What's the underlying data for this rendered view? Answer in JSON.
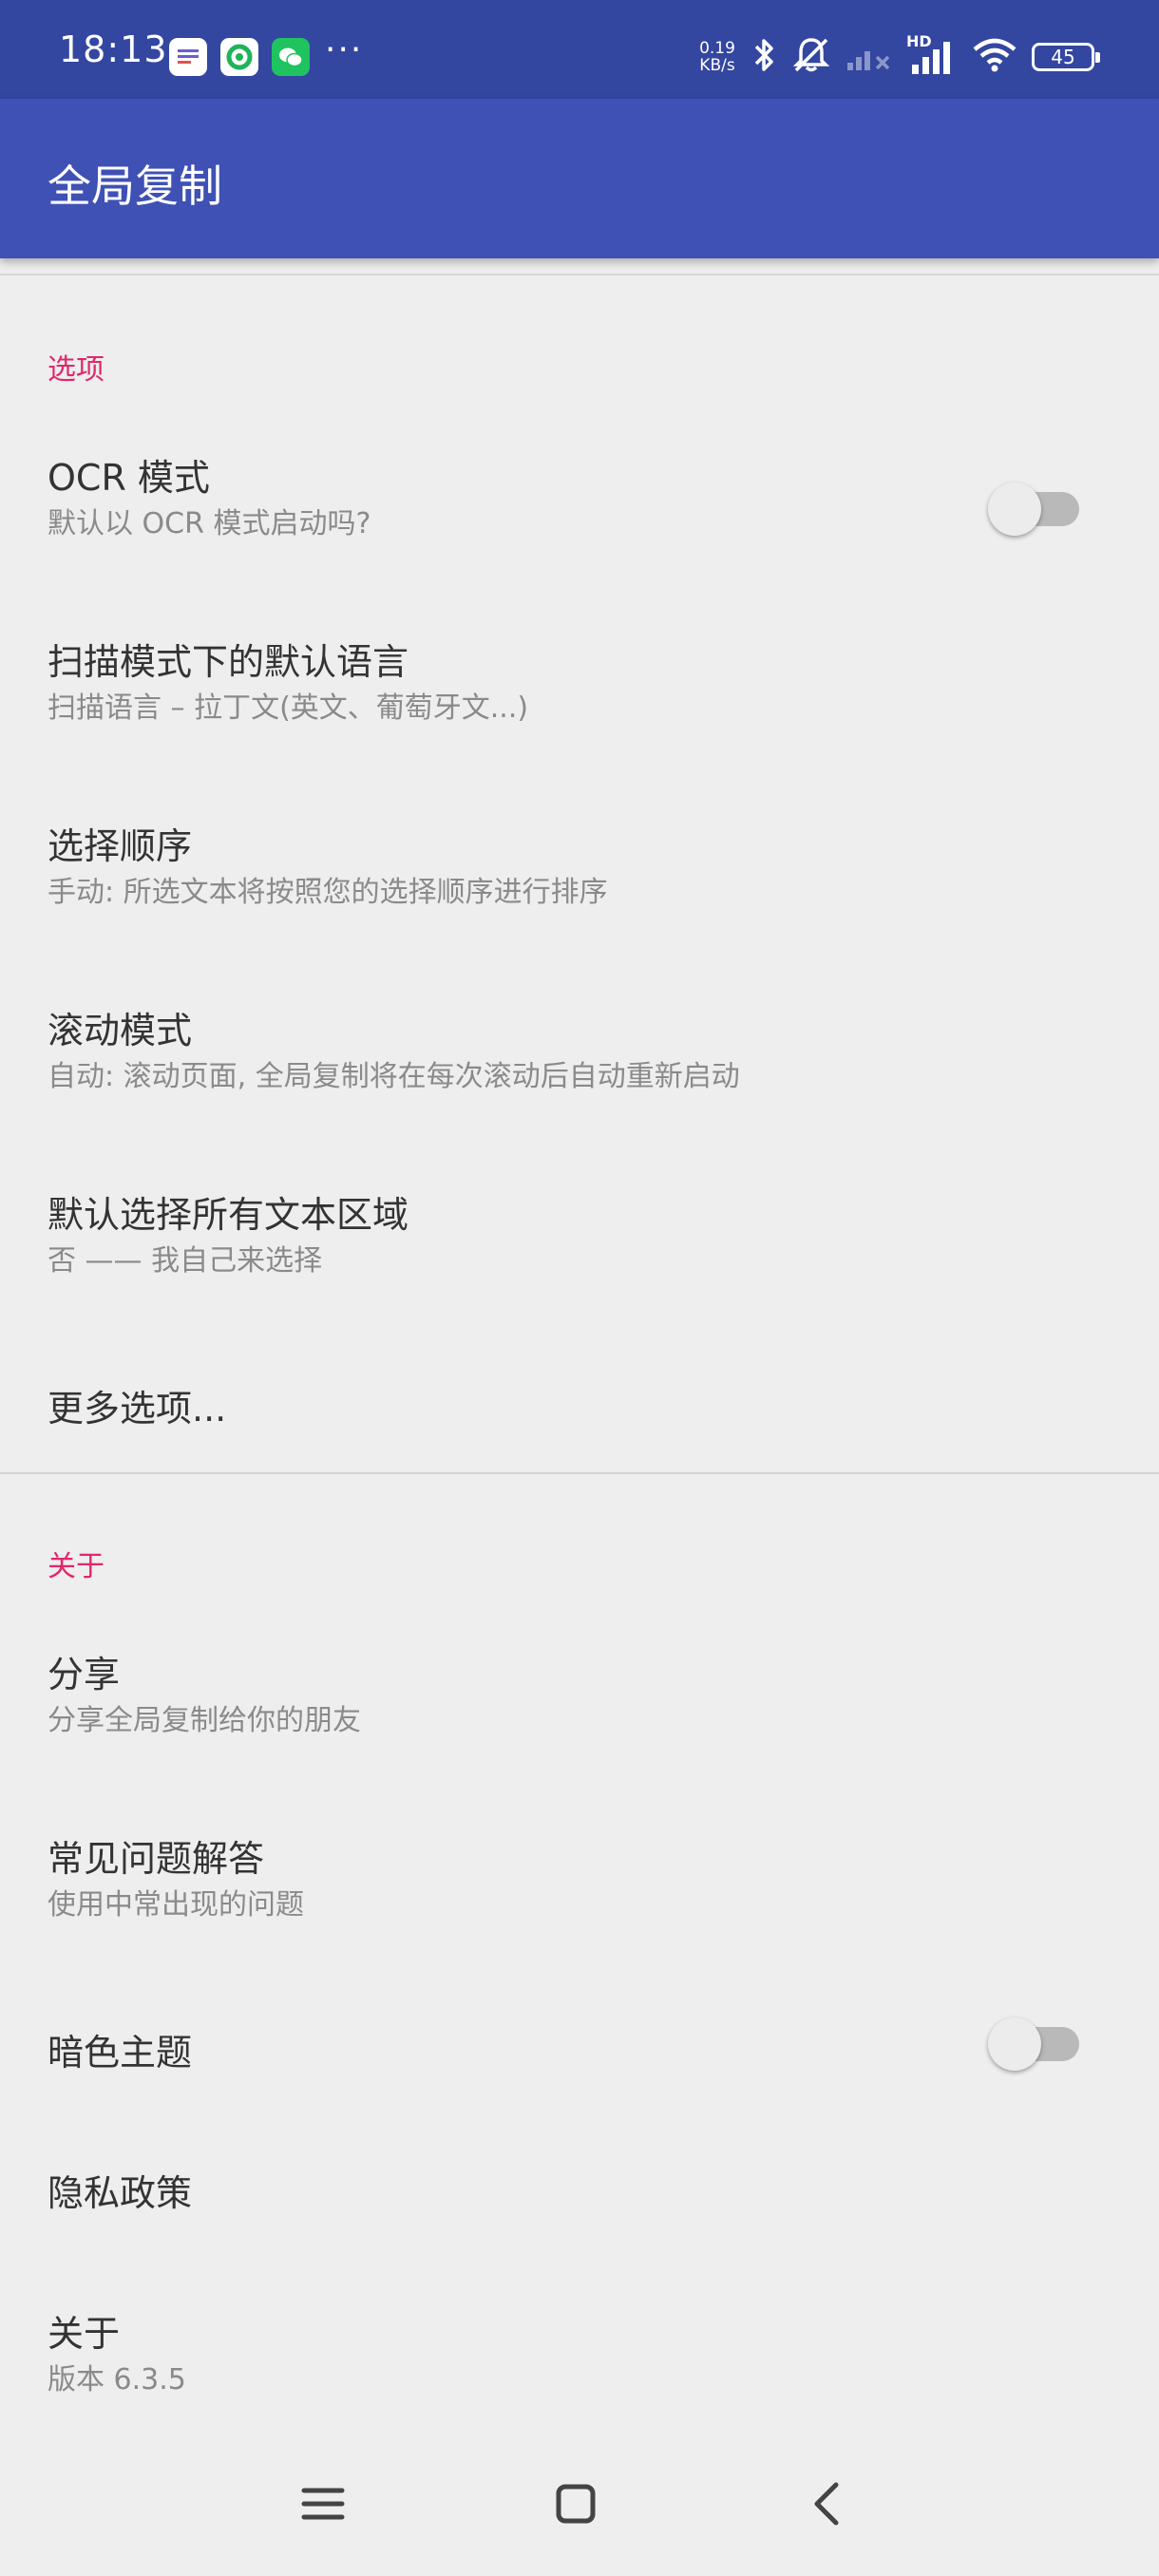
{
  "status_bar": {
    "time": "18:13",
    "net_speed_value": "0.19",
    "net_speed_unit": "KB/s",
    "network_label": "HD",
    "battery": "45"
  },
  "app_bar": {
    "title": "全局复制"
  },
  "sections": {
    "options": {
      "header": "选项",
      "ocr_mode": {
        "title": "OCR 模式",
        "summary": "默认以 OCR 模式启动吗?",
        "enabled": false
      },
      "scan_language": {
        "title": "扫描模式下的默认语言",
        "summary": "扫描语言 – 拉丁文(英文、葡萄牙文...)"
      },
      "selection_order": {
        "title": "选择顺序",
        "summary": "手动: 所选文本将按照您的选择顺序进行排序"
      },
      "scroll_mode": {
        "title": "滚动模式",
        "summary": "自动: 滚动页面, 全局复制将在每次滚动后自动重新启动"
      },
      "select_all": {
        "title": "默认选择所有文本区域",
        "summary": "否 —— 我自己来选择"
      },
      "more": {
        "title": "更多选项..."
      }
    },
    "about": {
      "header": "关于",
      "share": {
        "title": "分享",
        "summary": "分享全局复制给你的朋友"
      },
      "faq": {
        "title": "常见问题解答",
        "summary": "使用中常出现的问题"
      },
      "dark_theme": {
        "title": "暗色主题",
        "enabled": false
      },
      "privacy": {
        "title": "隐私政策"
      },
      "about_item": {
        "title": "关于",
        "summary": "版本 6.3.5"
      }
    }
  },
  "colors": {
    "status_bar": "#3346a0",
    "app_bar": "#3f51b5",
    "accent": "#e2266c",
    "background": "#eeeeee"
  },
  "icons": {
    "notifications": [
      "message-app-icon",
      "green-app-icon",
      "wechat-icon"
    ],
    "status": [
      "bluetooth-icon",
      "muted-bell-icon",
      "signal-icon",
      "signal-hd-icon",
      "wifi-icon",
      "battery-icon"
    ],
    "navigation": [
      "menu-icon",
      "home-icon",
      "back-icon"
    ]
  }
}
